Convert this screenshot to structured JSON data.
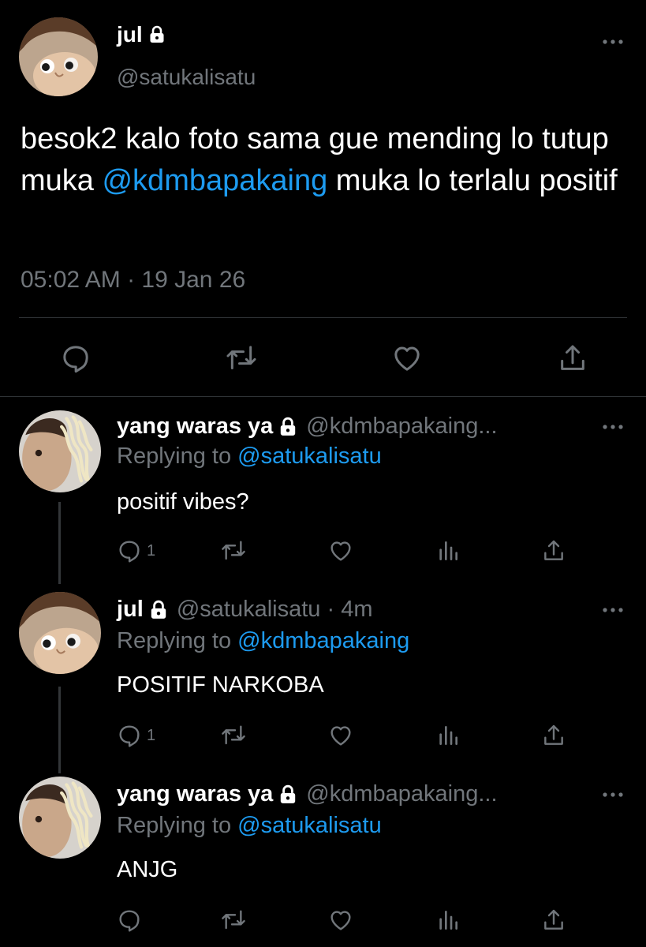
{
  "main_tweet": {
    "name": "jul",
    "handle": "@satukalisatu",
    "text_before": "besok2 kalo foto sama gue mending lo tutup muka ",
    "mention": "@kdmbapakaing",
    "text_after": " muka lo terlalu positif",
    "time": "05:02 AM · 19 Jan 26"
  },
  "replies": [
    {
      "name": "yang waras ya",
      "handle": "@kdmbapakaing...",
      "replying_prefix": "Replying to ",
      "replying_to": "@satukalisatu",
      "text": "positif vibes?",
      "reply_count": "1"
    },
    {
      "name": "jul",
      "handle": "@satukalisatu · 4m",
      "replying_prefix": "Replying to ",
      "replying_to": "@kdmbapakaing",
      "text": "POSITIF NARKOBA",
      "reply_count": "1"
    },
    {
      "name": "yang waras ya",
      "handle": "@kdmbapakaing...",
      "replying_prefix": "Replying to ",
      "replying_to": "@satukalisatu",
      "text": "ANJG",
      "reply_count": ""
    }
  ],
  "icons": {
    "lock": "lock-icon",
    "more": "more-icon",
    "reply": "reply-icon",
    "retweet": "retweet-icon",
    "like": "heart-icon",
    "views": "analytics-icon",
    "share": "share-icon"
  },
  "colors": {
    "background": "#000000",
    "text": "#e7e9ea",
    "secondary": "#71767b",
    "accent": "#1d9bf0",
    "divider": "#2f3336"
  }
}
